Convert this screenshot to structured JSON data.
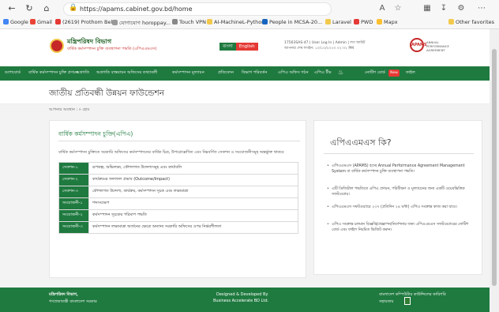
{
  "browser": {
    "url": "https://apams.cabinet.gov.bd/home",
    "bookmarks": [
      "Google",
      "Gmail",
      "(2619) Prothom Bel...",
      "যোগাযোগ horoppay...",
      "Touch VPN",
      "AI-MachineL-Python",
      "People in MCSA-20...",
      "Laravel",
      "PWD",
      "Mapx",
      "Other favorites"
    ]
  },
  "header": {
    "title": "মন্ত্রিপরিষদ বিভাগ",
    "subtitle": "বার্ষিক কর্মসম্পাদন চুক্তি ব্যবস্থাপনা পদ্ধতি (এপিএএমএস)",
    "lang_bn": "বাংলা",
    "lang_en": "English",
    "ministry_line_1": "17563SAS-47 | User Log In | Admin | লগ আউট",
    "ministry_line_2": "আপনার শেষ লগইন: ১০/১০/২০২৩ ০২:৩২ PM",
    "apams_badge": "APAMS",
    "apams_text_1": "ANNUAL",
    "apams_text_2": "PERFORMANCE",
    "apams_text_3": "AGREEMENT"
  },
  "nav": {
    "items": [
      "ড্যাশবোর্ড",
      "বার্ষিক কর্মসম্পাদন চুক্তি প্রণয়ন",
      "অগ্রগতি",
      "অগ্রগতি বাস্তবায়ন অফিসের তথ্যাবলী",
      "কর্মসম্পাদন মূল্যায়ন",
      "প্রতিবেদন",
      "বিভাগ পরিবর্তন",
      "এপিএ অফিস গঠন",
      "এপিএ টীম",
      "নোটিশ বোর্ড",
      "ফাইল"
    ],
    "badge": "New"
  },
  "page": {
    "title": "জাতীয় প্রতিবন্ধী উন্নয়ন ফাউন্ডেশন",
    "breadcrumb": "আপনার অবস্থান : » হোম"
  },
  "main_card": {
    "title": "বার্ষিক কর্মসম্পাদন চুক্তি(এপিএ)",
    "description": "বার্ষিক কর্মসম্পাদন চুক্তিতে সরকারি অফিসের কর্মসম্পাদনের বার্ষিক চিত্র, উপরোল্লেখিত এবং নিম্নবর্ণিত সেকশন ও সংযোজনীসমূহ অন্তর্ভুক্ত থাকবে",
    "rows": [
      {
        "key": "সেকশন-১",
        "value": "রূপকল্প, অভিলক্ষ্য, কৌশলগত উদ্দেশ্যসমূহ এবং কার্যাবলি"
      },
      {
        "key": "সেকশন-২",
        "value": "কার্যক্রমের ফলাফল প্রভাব (Outcome/Impact)"
      },
      {
        "key": "সেকশন-৩",
        "value": "কৌশলগত উদ্দেশ্য, কার্যক্রম, কর্মসম্পাদন সূচক এবং লক্ষ্যমাত্রা"
      },
      {
        "key": "সংযোজনী-১",
        "value": "শব্দসংক্ষেপ"
      },
      {
        "key": "সংযোজনী-২",
        "value": "কর্মসম্পাদন সূচকের পরিমাপ পদ্ধতি"
      },
      {
        "key": "সংযোজনী-৩",
        "value": "কর্মসম্পাদন লক্ষ্যমাত্রা অর্জনের ক্ষেত্রে অন্যান্য সরকারি অফিসের ওপর নির্ভরশীলতা"
      }
    ]
  },
  "side_card": {
    "title": "এপিএএমএস কি?",
    "items": [
      "এপিএএমএস (APAMS) হচ্ছে Annual Performance Agreement Management System বা বার্ষিক কর্মসম্পাদন চুক্তি ব্যবস্থাপনা পদ্ধতি।",
      "এটি ডিজিটাল পদ্ধতিতে এপিএ প্রণয়ন, পরিবীক্ষণ ও মূল্যায়নের জন্য একটি ওয়েবভিত্তিক সফটওয়্যার।",
      "এপিএএমএস সফটওয়্যারে ২৩৭ (প্রতিদিন ২৪ ঘন্টা) এপিএ সংক্রান্ত কাজ করা যাবে।",
      "এপিএ সংক্রান্ত চলমান বিজ্ঞপ্তি/প্রজ্ঞাপন/নির্দেশনার জন্য এপিএএমএস সফটওয়্যারের নোটিশ বোর্ড এবং ফাইল নিয়মিত ভিজিট করুন।"
    ]
  },
  "footer": {
    "left_1": "মন্ত্রিপরিষদ বিভাগ,",
    "left_2": "গণপ্রজাতন্ত্রী বাংলাদেশ সরকার",
    "center_1": "Designed & Developed By",
    "center_2": "Business Accelerate BD Ltd.",
    "right_1": "বাংলাদেশ কম্পিউটার কাউন্সিলের কারিগরি",
    "right_2": "সহায়তায়"
  }
}
